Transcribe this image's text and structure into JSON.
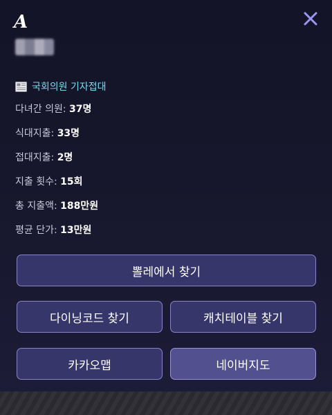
{
  "close_icon_color": "#9b96f0",
  "section": {
    "icon": "newspaper-icon",
    "title": "국회의원 기자접대"
  },
  "stats": [
    {
      "label": "다녀간 의원: ",
      "value": "37명"
    },
    {
      "label": "식대지출: ",
      "value": "33명"
    },
    {
      "label": "접대지출: ",
      "value": "2명"
    },
    {
      "label": "지출 횟수: ",
      "value": "15회"
    },
    {
      "label": "총 지출액: ",
      "value": "188만원"
    },
    {
      "label": "평균 단가: ",
      "value": "13만원"
    }
  ],
  "buttons": {
    "ppulle": "뽈레에서 찾기",
    "diningcode": "다이닝코드 찾기",
    "catchtable": "캐치테이블 찾기",
    "kakaomap": "카카오맵",
    "navermap": "네이버지도"
  }
}
